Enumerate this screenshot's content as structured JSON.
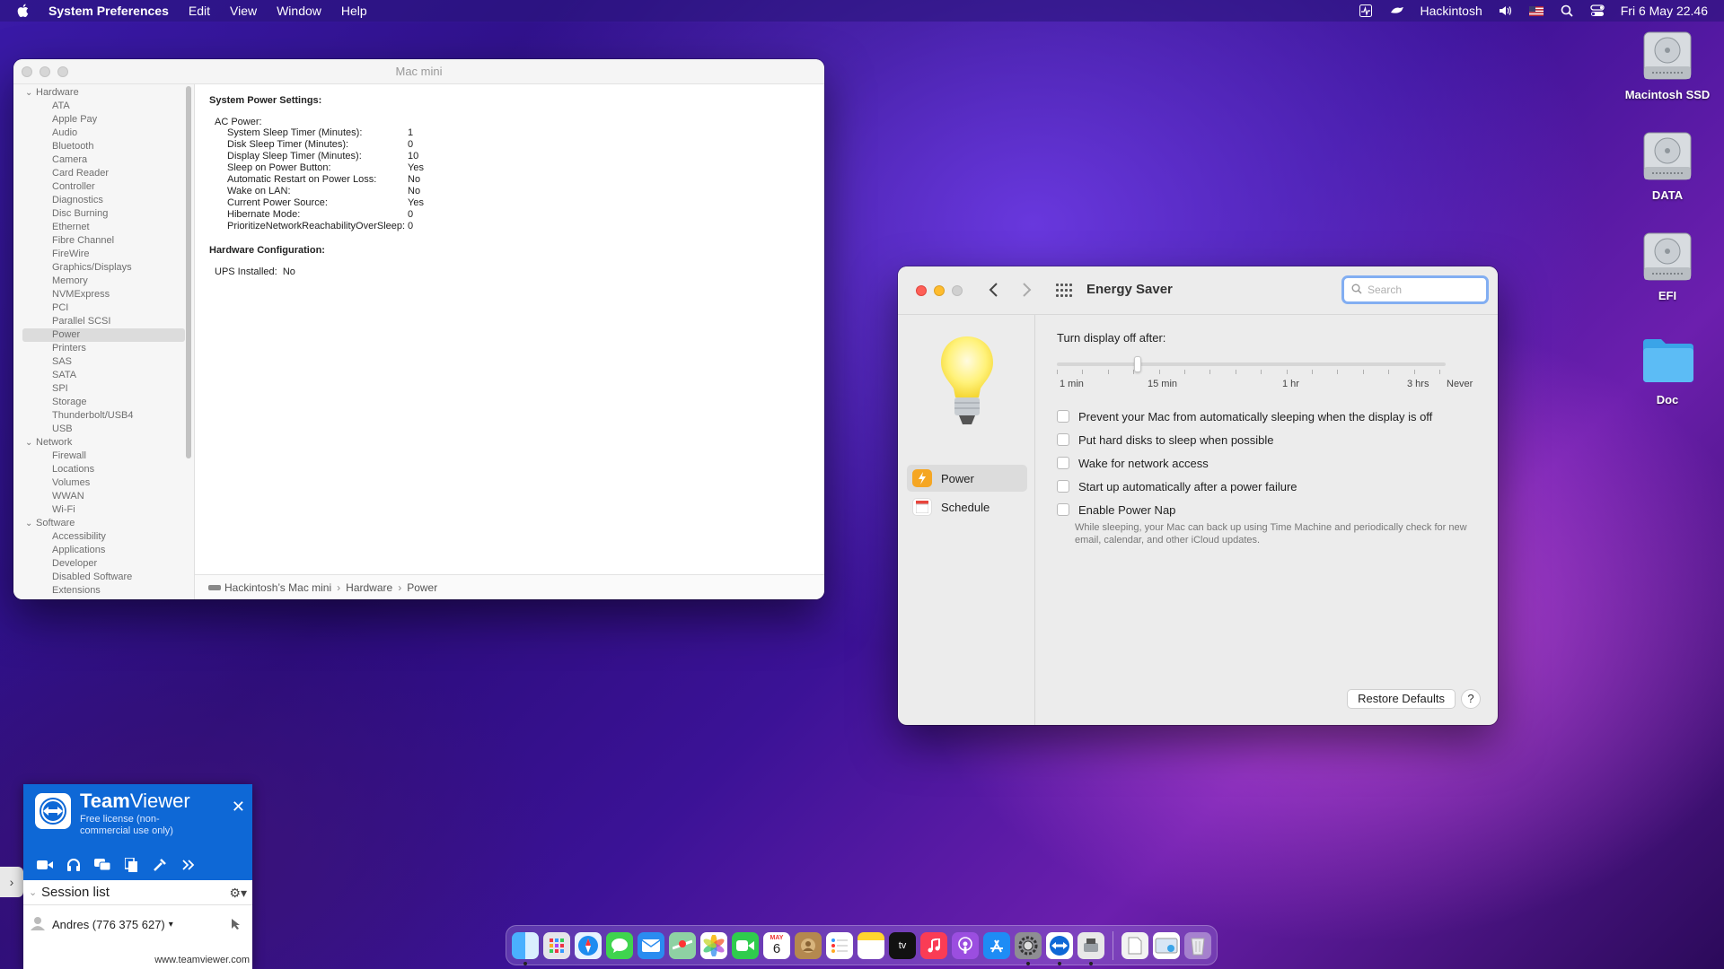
{
  "menubar": {
    "app": "System Preferences",
    "menus": [
      "Edit",
      "View",
      "Window",
      "Help"
    ],
    "user": "Hackintosh",
    "clock": "Fri 6 May  22.46"
  },
  "desktop": {
    "icons": [
      "Macintosh SSD",
      "DATA",
      "EFI",
      "Doc"
    ]
  },
  "sysinfo": {
    "window_title": "Mac mini",
    "sidebar": {
      "hardware_label": "Hardware",
      "hardware_items": [
        "ATA",
        "Apple Pay",
        "Audio",
        "Bluetooth",
        "Camera",
        "Card Reader",
        "Controller",
        "Diagnostics",
        "Disc Burning",
        "Ethernet",
        "Fibre Channel",
        "FireWire",
        "Graphics/Displays",
        "Memory",
        "NVMExpress",
        "PCI",
        "Parallel SCSI",
        "Power",
        "Printers",
        "SAS",
        "SATA",
        "SPI",
        "Storage",
        "Thunderbolt/USB4",
        "USB"
      ],
      "network_label": "Network",
      "network_items": [
        "Firewall",
        "Locations",
        "Volumes",
        "WWAN",
        "Wi-Fi"
      ],
      "software_label": "Software",
      "software_items": [
        "Accessibility",
        "Applications",
        "Developer",
        "Disabled Software",
        "Extensions"
      ],
      "selected": "Power"
    },
    "content": {
      "heading": "System Power Settings:",
      "ac_label": "AC Power:",
      "rows": [
        {
          "k": "System Sleep Timer (Minutes):",
          "v": "1"
        },
        {
          "k": "Disk Sleep Timer (Minutes):",
          "v": "0"
        },
        {
          "k": "Display Sleep Timer (Minutes):",
          "v": "10"
        },
        {
          "k": "Sleep on Power Button:",
          "v": "Yes"
        },
        {
          "k": "Automatic Restart on Power Loss:",
          "v": "No"
        },
        {
          "k": "Wake on LAN:",
          "v": "No"
        },
        {
          "k": "Current Power Source:",
          "v": "Yes"
        },
        {
          "k": "Hibernate Mode:",
          "v": "0"
        },
        {
          "k": "PrioritizeNetworkReachabilityOverSleep:",
          "v": "0"
        }
      ],
      "hw_heading": "Hardware Configuration:",
      "ups_label": "UPS Installed:",
      "ups_value": "No"
    },
    "pathbar": [
      "Hackintosh’s Mac mini",
      "Hardware",
      "Power"
    ]
  },
  "energy": {
    "title": "Energy Saver",
    "search_placeholder": "Search",
    "panes": [
      "Power",
      "Schedule"
    ],
    "display_off_label": "Turn display off after:",
    "slider_labels": [
      "1 min",
      "15 min",
      "1 hr",
      "3 hrs",
      "Never"
    ],
    "slider_value": "10 min",
    "options": [
      {
        "label": "Prevent your Mac from automatically sleeping when the display is off",
        "checked": false
      },
      {
        "label": "Put hard disks to sleep when possible",
        "checked": false
      },
      {
        "label": "Wake for network access",
        "checked": false
      },
      {
        "label": "Start up automatically after a power failure",
        "checked": false
      },
      {
        "label": "Enable Power Nap",
        "checked": false
      }
    ],
    "power_nap_note": "While sleeping, your Mac can back up using Time Machine and periodically check for new email, calendar, and other iCloud updates.",
    "restore_label": "Restore Defaults",
    "help_label": "?"
  },
  "teamviewer": {
    "brand_bold": "Team",
    "brand_light": "Viewer",
    "license": "Free license (non-commercial use only)",
    "session_list": "Session list",
    "user": "Andres (776 375 627)",
    "url": "www.teamviewer.com"
  },
  "dock": {
    "calendar_month": "MAY",
    "calendar_day": "6",
    "tv_label": "tv"
  },
  "colors": {
    "accent_blue": "#0e68d6",
    "close_red": "#fe5f57",
    "minimize_yellow": "#febc2e",
    "search_focus": "#82aef2"
  }
}
